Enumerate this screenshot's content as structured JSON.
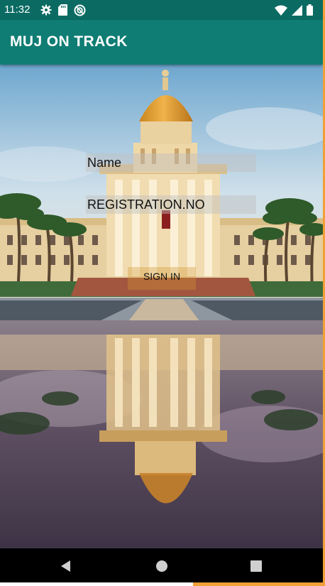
{
  "status_bar": {
    "time": "11:32",
    "left_icons": [
      "gear-icon",
      "sd-card-icon",
      "sync-icon"
    ],
    "right_icons": [
      "wifi-icon",
      "signal-icon",
      "battery-icon"
    ]
  },
  "app_bar": {
    "title": "MUJ ON TRACK"
  },
  "form": {
    "name_placeholder": "Name",
    "registration_placeholder": "REGISTRATION.NO",
    "sign_in_label": "SIGN IN"
  },
  "nav_bar": {
    "buttons": [
      "back-triangle-icon",
      "home-circle-icon",
      "recents-square-icon"
    ]
  },
  "colors": {
    "app_bar": "#0f7d74",
    "status_bar": "#0b6b63",
    "accent_strip": "#f0a036"
  }
}
